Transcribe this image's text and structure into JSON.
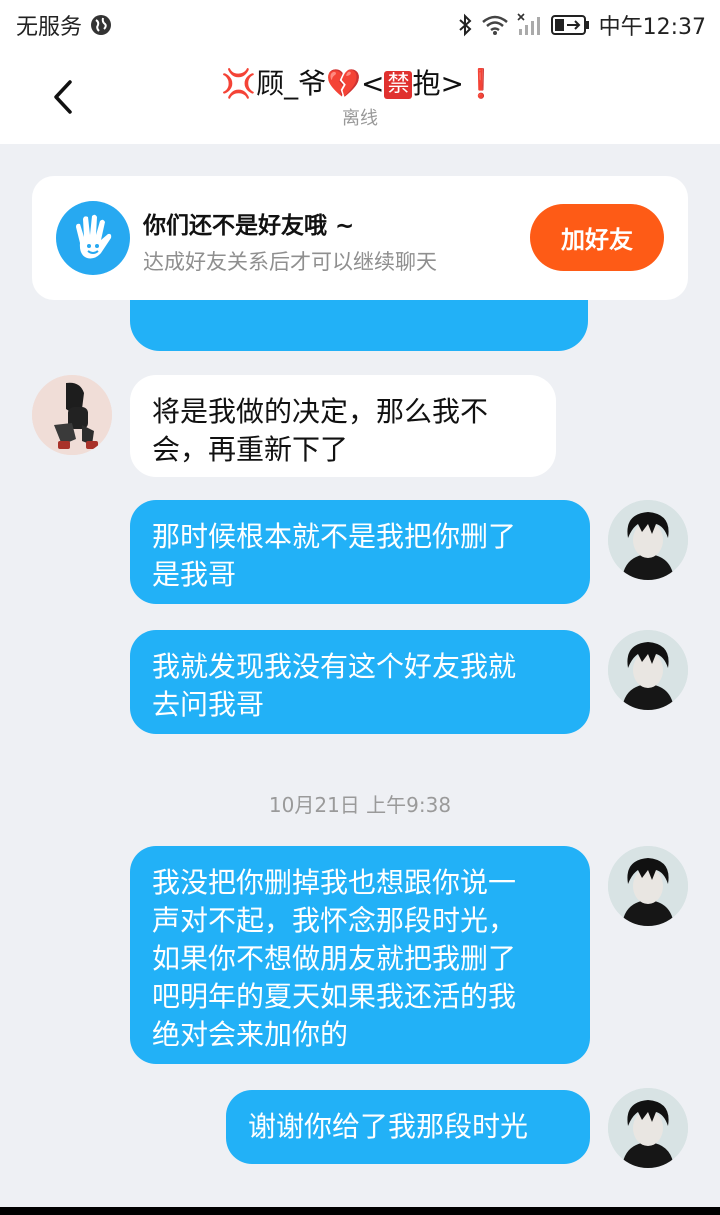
{
  "status_bar": {
    "carrier": "无服务",
    "time": "中午12:37",
    "icons": [
      "globe-icon",
      "bluetooth-icon",
      "wifi-icon",
      "signal-icon",
      "battery-icon"
    ]
  },
  "header": {
    "back_icon": "chevron-left-icon",
    "title_parts": [
      "💢",
      "顾_爷",
      "💔",
      "<",
      "禁",
      "抱>",
      "❗"
    ],
    "subtitle": "离线"
  },
  "friend_card": {
    "icon": "hand-wave-icon",
    "title": "你们还不是好友哦 ~",
    "subtitle": "达成好友关系后才可以继续聊天",
    "button": "加好友"
  },
  "messages": [
    {
      "side": "in",
      "text": "将是我做的决定，那么我不\n会，再重新下了"
    },
    {
      "side": "out",
      "text": "那时候根本就不是我把你删了\n是我哥"
    },
    {
      "side": "out",
      "text": "我就发现我没有这个好友我就\n去问我哥"
    },
    {
      "side": "out",
      "text": "我没把你删掉我也想跟你说一\n声对不起，我怀念那段时光，\n如果你不想做朋友就把我删了\n吧明年的夏天如果我还活的我\n绝对会来加你的"
    },
    {
      "side": "out",
      "text": "谢谢你给了我那段时光"
    }
  ],
  "timestamp": "10月21日 上午9:38",
  "colors": {
    "out_bubble": "#22b1f7",
    "add_button": "#fe5b16",
    "card_icon": "#27a9f1",
    "background": "#eef0f4"
  }
}
